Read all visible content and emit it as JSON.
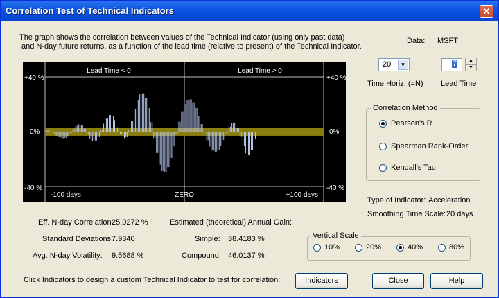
{
  "window": {
    "title": "Correlation Test of Technical Indicators",
    "close_glyph": "✕"
  },
  "description": {
    "line1": "The graph shows the correlation between values of the Technical Indicator (using only past data)",
    "line2": "and N-day future returns, as a function of the lead time (relative to present) of the Technical Indicator."
  },
  "chart": {
    "top_left_label": "Lead Time < 0",
    "top_right_label": "Lead Time > 0",
    "y_top": "+40 %",
    "y_zero": "0%",
    "y_bottom": "-40 %",
    "x_left": "-100 days",
    "x_center": "ZERO",
    "x_right": "+100 days"
  },
  "chart_data": {
    "type": "bar",
    "x_unit": "days",
    "xlim": [
      -100,
      100
    ],
    "ylim": [
      -40,
      40
    ],
    "y_unit": "%",
    "band": [
      -3,
      3
    ],
    "x_start": -100,
    "x_step": 2,
    "values": [
      1.1,
      0.8,
      0.0,
      -1.4,
      -2.9,
      -4.1,
      -4.8,
      -4.6,
      -3.2,
      -0.9,
      1.9,
      4.3,
      5.4,
      4.7,
      2.2,
      -1.5,
      -5.0,
      -6.8,
      -6.4,
      -3.6,
      0.8,
      5.8,
      10.0,
      12.1,
      11.6,
      8.4,
      3.2,
      -1.9,
      -4.7,
      -3.8,
      0.8,
      8.1,
      16.2,
      23.1,
      27.3,
      28.0,
      24.6,
      17.3,
      7.0,
      -4.6,
      -15.6,
      -24.1,
      -28.9,
      -29.4,
      -25.9,
      -19.3,
      -10.8,
      -1.6,
      7.3,
      14.9,
      20.3,
      23.3,
      23.6,
      21.5,
      17.3,
      11.7,
      5.5,
      -0.7,
      -6.3,
      -10.8,
      -13.7,
      -14.6,
      -13.5,
      -10.5,
      -6.0,
      -0.8,
      3.8,
      6.6,
      6.4,
      3.0,
      -3.4,
      -10.6,
      -15.8,
      -17.0,
      -13.2,
      -5.0
    ]
  },
  "data_label": "Data:",
  "data_value": "MSFT",
  "time_horiz": {
    "value": "20",
    "label": "Time Horiz. (=N)"
  },
  "lead_time": {
    "value": "7",
    "label": "Lead Time"
  },
  "correlation_method": {
    "legend": "Correlation Method",
    "options": [
      "Pearson's R",
      "Spearman Rank-Order",
      "Kendall's Tau"
    ],
    "selected": "Pearson's R"
  },
  "type_of_indicator": {
    "label": "Type of Indicator:",
    "value": "Acceleration"
  },
  "smoothing": {
    "label": "Smoothing Time Scale:",
    "value": "20 days"
  },
  "stats": {
    "eff_corr_label": "Eff. N-day Correlation:",
    "eff_corr_value": "25.0272 %",
    "std_dev_label": "Standard Deviations:",
    "std_dev_value": "7.9340",
    "volatility_label": "Avg. N-day Volatility:",
    "volatility_value": "9.5688 %",
    "gain_label": "Estimated (theoretical) Annual Gain:",
    "simple_label": "Simple:",
    "simple_value": "38.4183 %",
    "compound_label": "Compound:",
    "compound_value": "46.0137 %"
  },
  "vertical_scale": {
    "legend": "Vertical Scale",
    "options": [
      "10%",
      "20%",
      "40%",
      "80%"
    ],
    "selected": "40%"
  },
  "footer": {
    "hint": "Click Indicators to design a custom Technical Indicator to test for correlation:",
    "indicators_button": "Indicators",
    "close_button": "Close",
    "help_button": "Help"
  },
  "colors": {
    "title_bar": "#0a54e0",
    "chart_bg": "#000000",
    "band": "#8a7e10",
    "bars": "#b8c8f0"
  }
}
